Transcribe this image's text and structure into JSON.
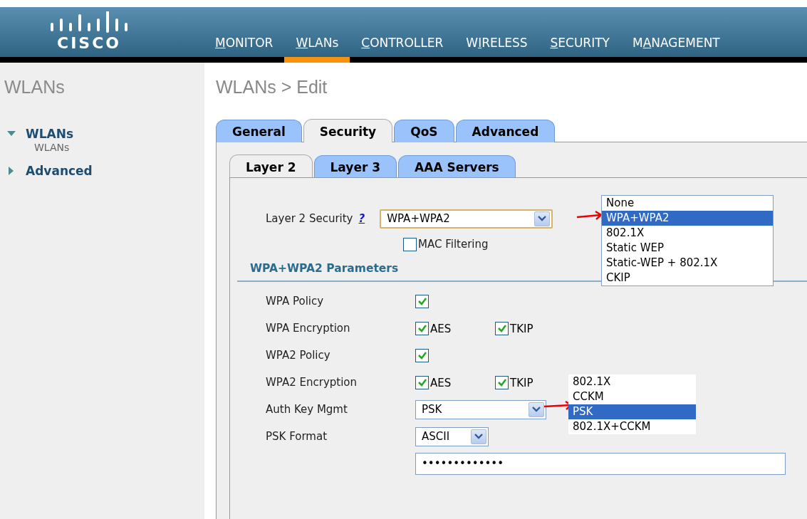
{
  "logo": {
    "text": "CISCO"
  },
  "nav": [
    {
      "segments": [
        {
          "text": "M",
          "underlined": true
        },
        {
          "text": "ONITOR",
          "underlined": false
        }
      ],
      "selected": false
    },
    {
      "segments": [
        {
          "text": "W",
          "underlined": true
        },
        {
          "text": "LANs",
          "underlined": false
        }
      ],
      "selected": true
    },
    {
      "segments": [
        {
          "text": "C",
          "underlined": true
        },
        {
          "text": "ONTROLLER",
          "underlined": false
        }
      ],
      "selected": false
    },
    {
      "segments": [
        {
          "text": "W",
          "underlined": false
        },
        {
          "text": "I",
          "underlined": true
        },
        {
          "text": "RELESS",
          "underlined": false
        }
      ],
      "selected": false
    },
    {
      "segments": [
        {
          "text": "S",
          "underlined": true
        },
        {
          "text": "ECURITY",
          "underlined": false
        }
      ],
      "selected": false
    },
    {
      "segments": [
        {
          "text": "M",
          "underlined": false
        },
        {
          "text": "A",
          "underlined": true
        },
        {
          "text": "NAGEMENT",
          "underlined": false
        }
      ],
      "selected": false
    }
  ],
  "sidebar": {
    "title": "WLANs",
    "items": [
      {
        "label": "WLANs",
        "expanded": true,
        "children": [
          {
            "label": "WLANs"
          }
        ]
      },
      {
        "label": "Advanced",
        "expanded": false
      }
    ]
  },
  "page_title": "WLANs > Edit",
  "tabs": [
    {
      "label": "General",
      "selected": false
    },
    {
      "label": "Security",
      "selected": true
    },
    {
      "label": "QoS",
      "selected": false
    },
    {
      "label": "Advanced",
      "selected": false
    }
  ],
  "subtabs": [
    {
      "label": "Layer 2",
      "selected": true
    },
    {
      "label": "Layer 3",
      "selected": false
    },
    {
      "label": "AAA Servers",
      "selected": false
    }
  ],
  "layer2_security": {
    "label": "Layer 2 Security",
    "help": "?",
    "value": "WPA+WPA2",
    "open_list": [
      {
        "label": "None",
        "selected": false
      },
      {
        "label": "WPA+WPA2",
        "selected": true
      },
      {
        "label": "802.1X",
        "selected": false
      },
      {
        "label": "Static WEP",
        "selected": false
      },
      {
        "label": "Static-WEP + 802.1X",
        "selected": false
      },
      {
        "label": "CKIP",
        "selected": false
      }
    ]
  },
  "mac_filtering": {
    "label": "MAC Filtering",
    "checked": false
  },
  "section_title": "WPA+WPA2 Parameters",
  "params": [
    {
      "kind": "checkbox",
      "label": "WPA Policy",
      "checked": true
    },
    {
      "kind": "checkboxes",
      "label": "WPA Encryption",
      "options": [
        {
          "label": "AES",
          "checked": true
        },
        {
          "label": "TKIP",
          "checked": true
        }
      ]
    },
    {
      "kind": "checkbox",
      "label": "WPA2 Policy",
      "checked": true
    },
    {
      "kind": "checkboxes",
      "label": "WPA2 Encryption",
      "options": [
        {
          "label": "AES",
          "checked": true
        },
        {
          "label": "TKIP",
          "checked": true
        }
      ]
    },
    {
      "kind": "select",
      "label": "Auth Key Mgmt",
      "value": "PSK",
      "open_list": [
        {
          "label": "802.1X",
          "selected": false
        },
        {
          "label": "CCKM",
          "selected": false
        },
        {
          "label": "PSK",
          "selected": true
        },
        {
          "label": "802.1X+CCKM",
          "selected": false
        }
      ]
    },
    {
      "kind": "compact-select",
      "label": "PSK Format",
      "value": "ASCII"
    },
    {
      "kind": "field",
      "value": "•••••••••••••"
    }
  ]
}
